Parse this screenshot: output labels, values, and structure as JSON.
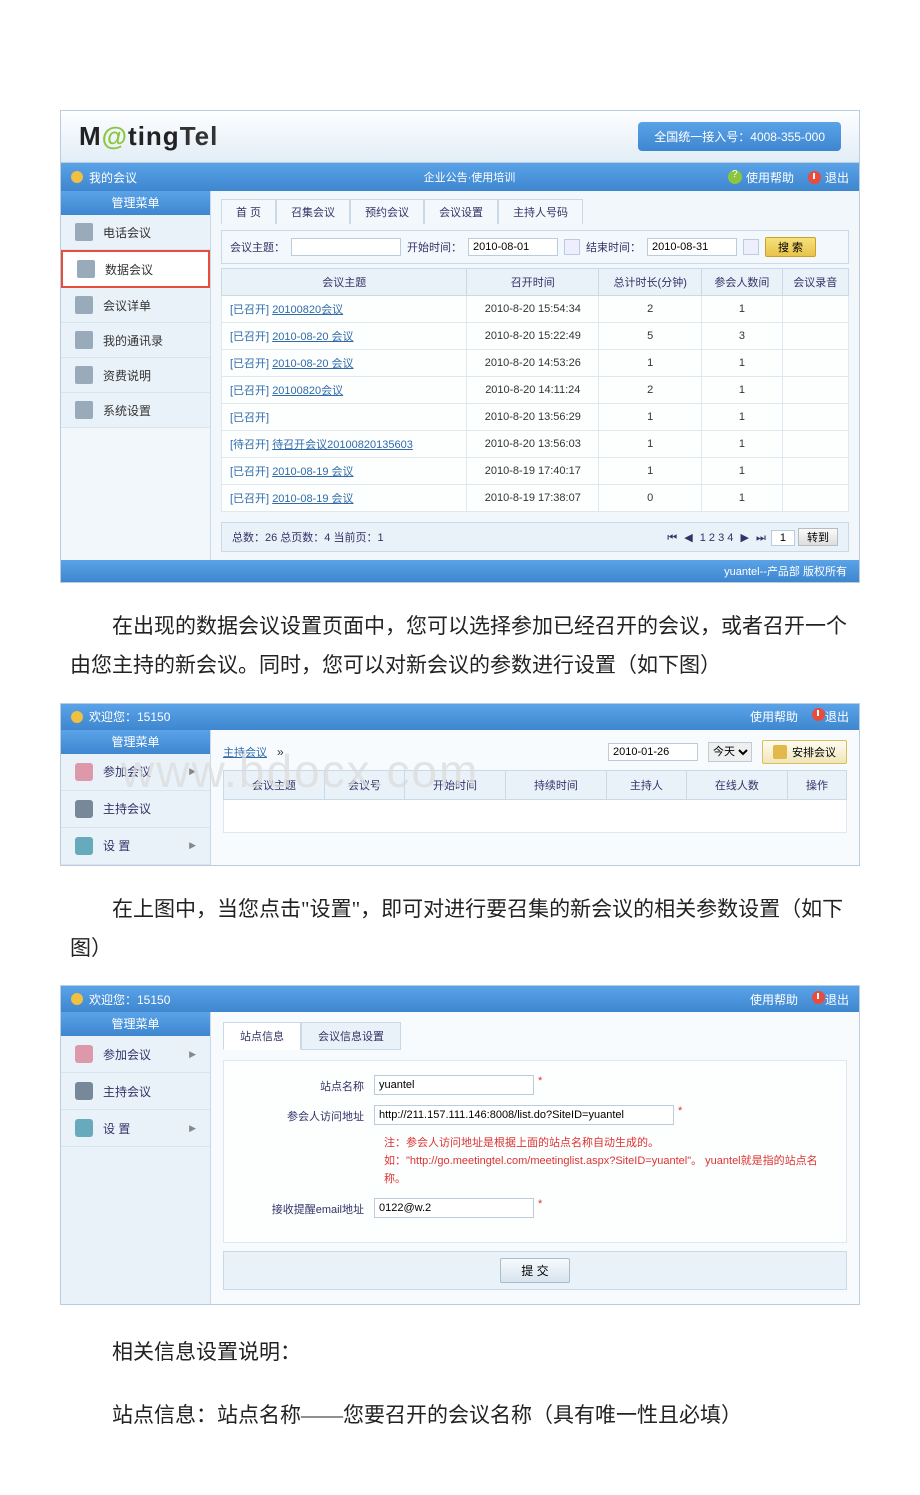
{
  "s1": {
    "logo": {
      "m": "M",
      "at": "@",
      "rest": "ting",
      "tel": "Tel"
    },
    "hotline": "全国统一接入号：4008-355-000",
    "myMeeting": "我的会议",
    "announce": "企业公告·使用培训",
    "help": "使用帮助",
    "logout": "退出",
    "menuTitle": "管理菜单",
    "sidebar": [
      "电话会议",
      "数据会议",
      "会议详单",
      "我的通讯录",
      "资费说明",
      "系统设置"
    ],
    "subtabs": [
      "首 页",
      "召集会议",
      "预约会议",
      "会议设置",
      "主持人号码"
    ],
    "search": {
      "topicLabel": "会议主题：",
      "startLabel": "开始时间：",
      "start": "2010-08-01",
      "endLabel": "结束时间：",
      "end": "2010-08-31",
      "btn": "搜 索"
    },
    "cols": [
      "会议主题",
      "召开时间",
      "总计时长(分钟)",
      "参会人数间",
      "会议录音"
    ],
    "rows": [
      {
        "st": "[已召开]",
        "t": "20100820会议",
        "time": "2010-8-20 15:54:34",
        "d": "2",
        "p": "1",
        "r": ""
      },
      {
        "st": "[已召开]",
        "t": "2010-08-20 会议",
        "time": "2010-8-20 15:22:49",
        "d": "5",
        "p": "3",
        "r": ""
      },
      {
        "st": "[已召开]",
        "t": "2010-08-20 会议",
        "time": "2010-8-20 14:53:26",
        "d": "1",
        "p": "1",
        "r": ""
      },
      {
        "st": "[已召开]",
        "t": "20100820会议",
        "time": "2010-8-20 14:11:24",
        "d": "2",
        "p": "1",
        "r": ""
      },
      {
        "st": "[已召开]",
        "t": "",
        "time": "2010-8-20 13:56:29",
        "d": "1",
        "p": "1",
        "r": ""
      },
      {
        "st": "[待召开]",
        "t": "待召开会议20100820135603",
        "time": "2010-8-20 13:56:03",
        "d": "1",
        "p": "1",
        "r": ""
      },
      {
        "st": "[已召开]",
        "t": "2010-08-19 会议",
        "time": "2010-8-19 17:40:17",
        "d": "1",
        "p": "1",
        "r": ""
      },
      {
        "st": "[已召开]",
        "t": "2010-08-19 会议",
        "time": "2010-8-19 17:38:07",
        "d": "0",
        "p": "1",
        "r": ""
      }
    ],
    "pager": {
      "info": "总数：26 总页数：4 当前页：1",
      "nums": "1 2 3 4",
      "go": "1",
      "goBtn": "转到"
    },
    "footer": "yuantel--产品部 版权所有"
  },
  "para1": "在出现的数据会议设置页面中，您可以选择参加已经召开的会议，或者召开一个由您主持的新会议。同时，您可以对新会议的参数进行设置（如下图）",
  "para2": "在上图中，当您点击\"设置\"，即可对进行要召集的新会议的相关参数设置（如下图）",
  "para3": "相关信息设置说明：",
  "para4": "站点信息：站点名称——您要召开的会议名称（具有唯一性且必填）",
  "watermark": "www.bdocx.com",
  "s2": {
    "welcome": "欢迎您：15150",
    "help": "使用帮助",
    "logout": "退出",
    "menuTitle": "管理菜单",
    "sidebar": [
      {
        "t": "参加会议",
        "arr": "▶"
      },
      {
        "t": "主持会议",
        "arr": ""
      },
      {
        "t": "设 置",
        "arr": "▶"
      }
    ],
    "hostLink": "主持会议",
    "chev": "»",
    "date": "2010-01-26",
    "sel": "今天",
    "arrange": "安排会议",
    "cols": [
      "会议主题",
      "会议号",
      "开始时间",
      "持续时间",
      "主持人",
      "在线人数",
      "操作"
    ]
  },
  "s3": {
    "welcome": "欢迎您：15150",
    "help": "使用帮助",
    "logout": "退出",
    "menuTitle": "管理菜单",
    "sidebar": [
      {
        "t": "参加会议",
        "arr": "▶"
      },
      {
        "t": "主持会议",
        "arr": ""
      },
      {
        "t": "设 置",
        "arr": "▶"
      }
    ],
    "tabs": [
      "站点信息",
      "会议信息设置"
    ],
    "form": {
      "siteLabel": "站点名称",
      "siteVal": "yuantel",
      "urlLabel": "参会人访问地址",
      "urlVal": "http://211.157.111.146:8008/list.do?SiteID=yuantel",
      "note": "注：参会人访问地址是根据上面的站点名称自动生成的。\n如：\"http://go.meetingtel.com/meetinglist.aspx?SiteID=yuantel\"。 yuantel就是指的站点名称。",
      "emailLabel": "接收提醒email地址",
      "emailVal": "0122@w.2",
      "submit": "提 交"
    }
  }
}
